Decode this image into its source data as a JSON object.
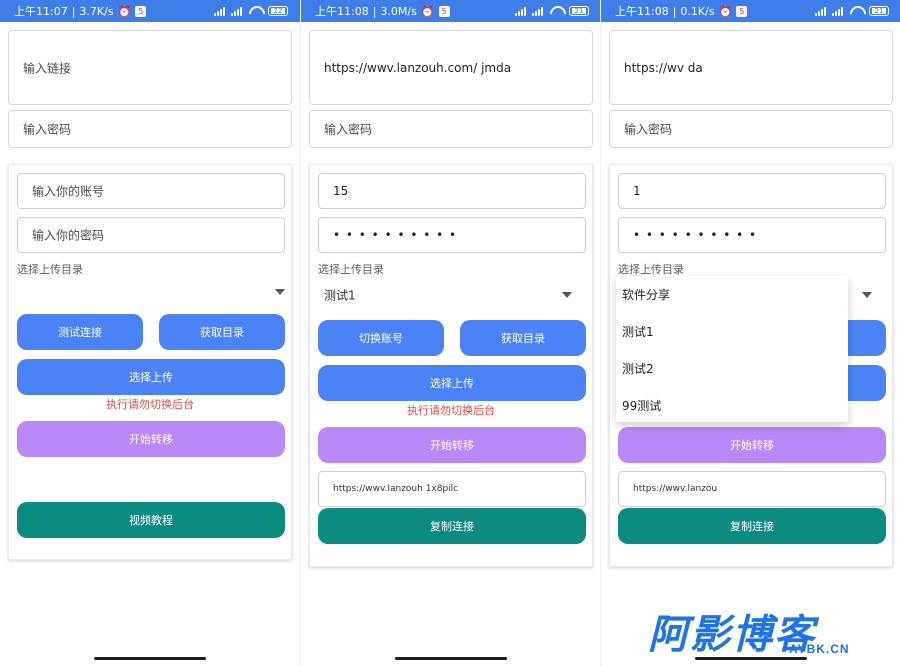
{
  "theme": {
    "status_bar": "#3f7de8",
    "button": "#4b83f6",
    "purple": "#b88af8",
    "teal": "#0c8b7f",
    "warning": "#e14b4b"
  },
  "panel1": {
    "status_time": "上午11:07",
    "status_speed": "3.7K/s",
    "battery": "22",
    "link_placeholder": "输入链接",
    "pass_placeholder": "输入密码",
    "account_placeholder": "输入你的账号",
    "account_pass_placeholder": "输入你的密码",
    "dir_label": "选择上传目录",
    "btn_test": "测试连接",
    "btn_get": "获取目录",
    "btn_upload": "选择上传",
    "warning": "执行请勿切换后台",
    "btn_transfer": "开始转移",
    "btn_video": "视频教程"
  },
  "panel2": {
    "status_time": "上午11:08",
    "status_speed": "3.0M/s",
    "battery": "21",
    "link_value": "https://wwv.lanzouh.com/ jmda",
    "pass_placeholder": "输入密码",
    "account_value": "15",
    "account_pass_value": "• • • • • • • • • •",
    "dir_label": "选择上传目录",
    "dir_value": "测试1",
    "btn_switch": "切换账号",
    "btn_get": "获取目录",
    "btn_upload": "选择上传",
    "warning": "执行请勿切换后台",
    "btn_transfer": "开始转移",
    "link_result": "https://wwv.lanzouh 1x8pilc",
    "btn_copy": "复制连接"
  },
  "panel3": {
    "status_time": "上午11:08",
    "status_speed": "0.1K/s",
    "battery": "21",
    "link_value": "https://wv da",
    "pass_placeholder": "输入密码",
    "account_value": "1",
    "account_pass_value": "• • • • • • • • • •",
    "dir_label": "选择上传目录",
    "btn_transfer": "开始转移",
    "link_result": "https://wwv.lanzou",
    "btn_copy": "复制连接"
  },
  "dropdown": {
    "items": [
      "软件分享",
      "测试1",
      "测试2",
      "99测试"
    ]
  },
  "brand": {
    "logo_text": "阿影博客",
    "logo_domain": "AYBK.CN"
  }
}
